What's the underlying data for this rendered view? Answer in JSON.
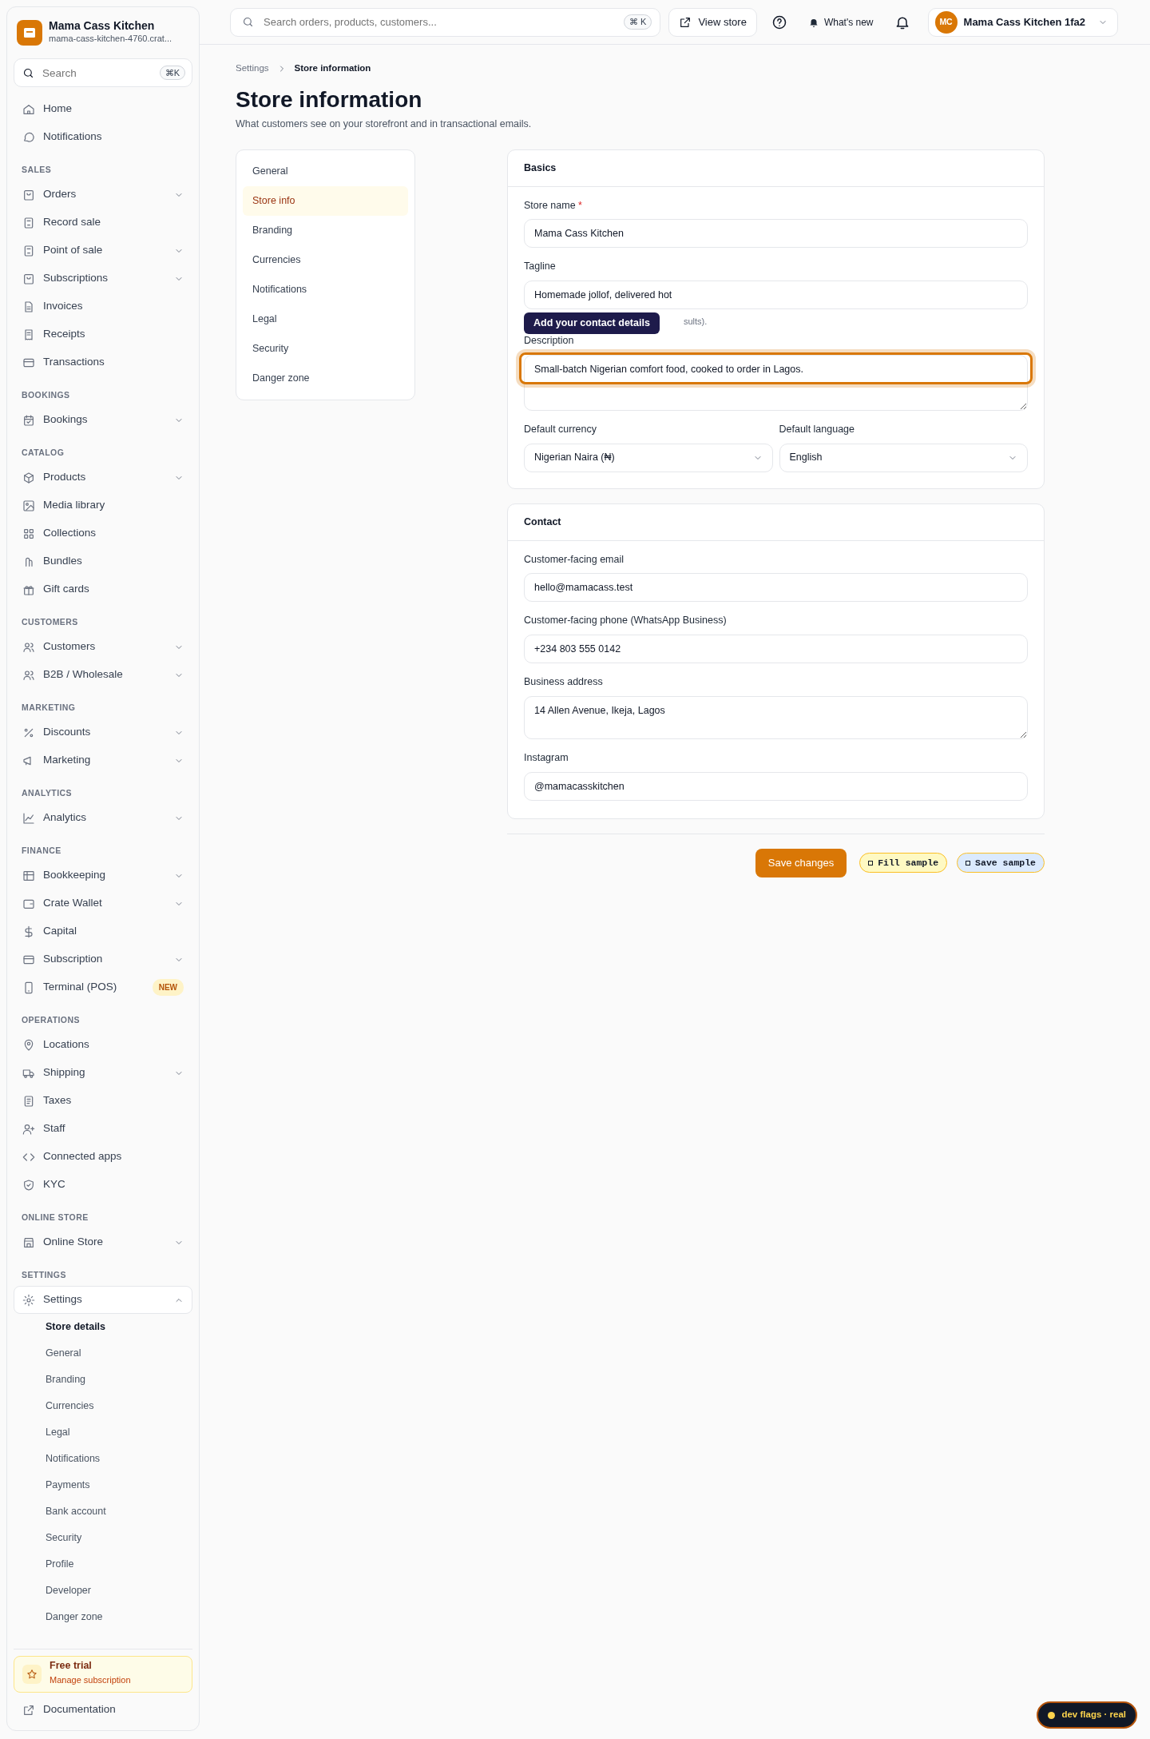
{
  "brand": {
    "name": "Mama Cass Kitchen",
    "subdomain": "mama-cass-kitchen-4760.crat..."
  },
  "sidebar_search": {
    "placeholder": "Search",
    "shortcut": "⌘K"
  },
  "sidebar": {
    "sections": [
      {
        "items": [
          {
            "label": "Home",
            "kind": "link"
          },
          {
            "label": "Notifications",
            "kind": "link"
          }
        ]
      },
      {
        "heading": "SALES",
        "items": [
          {
            "label": "Orders",
            "kind": "group",
            "expanded": false
          },
          {
            "label": "Record sale",
            "kind": "link"
          },
          {
            "label": "Point of sale",
            "kind": "group",
            "expanded": false
          },
          {
            "label": "Subscriptions",
            "kind": "group",
            "expanded": false
          },
          {
            "label": "Invoices",
            "kind": "link"
          },
          {
            "label": "Receipts",
            "kind": "link"
          },
          {
            "label": "Transactions",
            "kind": "link"
          }
        ]
      },
      {
        "heading": "BOOKINGS",
        "items": [
          {
            "label": "Bookings",
            "kind": "group",
            "expanded": false
          }
        ]
      },
      {
        "heading": "CATALOG",
        "items": [
          {
            "label": "Products",
            "kind": "group",
            "expanded": false
          },
          {
            "label": "Media library",
            "kind": "link"
          },
          {
            "label": "Collections",
            "kind": "link"
          },
          {
            "label": "Bundles",
            "kind": "link"
          },
          {
            "label": "Gift cards",
            "kind": "link"
          }
        ]
      },
      {
        "heading": "CUSTOMERS",
        "items": [
          {
            "label": "Customers",
            "kind": "group",
            "expanded": false
          },
          {
            "label": "B2B / Wholesale",
            "kind": "group",
            "expanded": false
          }
        ]
      },
      {
        "heading": "MARKETING",
        "items": [
          {
            "label": "Discounts",
            "kind": "group",
            "expanded": false
          },
          {
            "label": "Marketing",
            "kind": "group",
            "expanded": false
          }
        ]
      },
      {
        "heading": "ANALYTICS",
        "items": [
          {
            "label": "Analytics",
            "kind": "group",
            "expanded": false
          }
        ]
      },
      {
        "heading": "FINANCE",
        "items": [
          {
            "label": "Bookkeeping",
            "kind": "group",
            "expanded": false
          },
          {
            "label": "Crate Wallet",
            "kind": "group",
            "expanded": false
          },
          {
            "label": "Capital",
            "kind": "link"
          },
          {
            "label": "Subscription",
            "kind": "group",
            "expanded": false
          },
          {
            "label": "Terminal (POS)",
            "kind": "link",
            "badge": "NEW"
          }
        ]
      },
      {
        "heading": "OPERATIONS",
        "items": [
          {
            "label": "Locations",
            "kind": "link"
          },
          {
            "label": "Shipping",
            "kind": "group",
            "expanded": false
          },
          {
            "label": "Taxes",
            "kind": "link"
          },
          {
            "label": "Staff",
            "kind": "link"
          },
          {
            "label": "Connected apps",
            "kind": "link"
          },
          {
            "label": "KYC",
            "kind": "link"
          }
        ]
      },
      {
        "heading": "ONLINE STORE",
        "items": [
          {
            "label": "Online Store",
            "kind": "group",
            "expanded": false
          }
        ]
      },
      {
        "heading": "SETTINGS",
        "items": [
          {
            "label": "Settings",
            "kind": "group",
            "expanded": true,
            "children": [
              {
                "label": "Store details",
                "selected": true
              },
              {
                "label": "General",
                "selected": false
              },
              {
                "label": "Branding",
                "selected": false
              },
              {
                "label": "Currencies",
                "selected": false
              },
              {
                "label": "Legal",
                "selected": false
              },
              {
                "label": "Notifications",
                "selected": false
              },
              {
                "label": "Payments",
                "selected": false
              },
              {
                "label": "Bank account",
                "selected": false
              },
              {
                "label": "Security",
                "selected": false
              },
              {
                "label": "Profile",
                "selected": false
              },
              {
                "label": "Developer",
                "selected": false
              },
              {
                "label": "Danger zone",
                "selected": false
              }
            ]
          }
        ]
      }
    ]
  },
  "trial": {
    "title": "Free trial",
    "link": "Manage subscription"
  },
  "documentation": "Documentation",
  "topbar": {
    "search_placeholder": "Search orders, products, customers...",
    "shortcut": "⌘ K",
    "view_store": "View store",
    "whats_new": "What's new",
    "account_initials": "MC",
    "account_name": "Mama Cass Kitchen 1fa2"
  },
  "breadcrumb": [
    "Settings",
    "Store information"
  ],
  "page": {
    "title": "Store information",
    "subtitle": "What customers see on your storefront and in transactional emails."
  },
  "settings_nav": [
    {
      "label": "General",
      "selected": false
    },
    {
      "label": "Store info",
      "selected": true
    },
    {
      "label": "Branding",
      "selected": false
    },
    {
      "label": "Currencies",
      "selected": false
    },
    {
      "label": "Notifications",
      "selected": false
    },
    {
      "label": "Legal",
      "selected": false
    },
    {
      "label": "Security",
      "selected": false
    },
    {
      "label": "Danger zone",
      "selected": false
    }
  ],
  "basics": {
    "title": "Basics",
    "store_name": {
      "label": "Store name",
      "required_mark": "*",
      "value": "Mama Cass Kitchen"
    },
    "tagline": {
      "label": "Tagline",
      "value": "Homemade jollof, delivered hot",
      "hint": "sults)."
    },
    "tooltip": "Add your contact details",
    "description": {
      "label": "Description",
      "value": "Small-batch Nigerian comfort food, cooked to order in Lagos.",
      "highlighted": true
    },
    "currency": {
      "label": "Default currency",
      "value": "Nigerian Naira (₦)"
    },
    "language": {
      "label": "Default language",
      "value": "English"
    }
  },
  "contact": {
    "title": "Contact",
    "fields": [
      {
        "label": "Customer-facing email",
        "value": "hello@mamacass.test",
        "kind": "input"
      },
      {
        "label": "Customer-facing phone (WhatsApp Business)",
        "value": "+234 803 555 0142",
        "kind": "input"
      },
      {
        "label": "Business address",
        "value": "14 Allen Avenue, Ikeja, Lagos",
        "kind": "textarea"
      },
      {
        "label": "Instagram",
        "value": "@mamacasskitchen",
        "kind": "input"
      }
    ]
  },
  "actions": {
    "save": "Save changes",
    "fill_sample": "Fill sample",
    "save_sample": "Save sample"
  },
  "dev_flags": "dev flags · real"
}
